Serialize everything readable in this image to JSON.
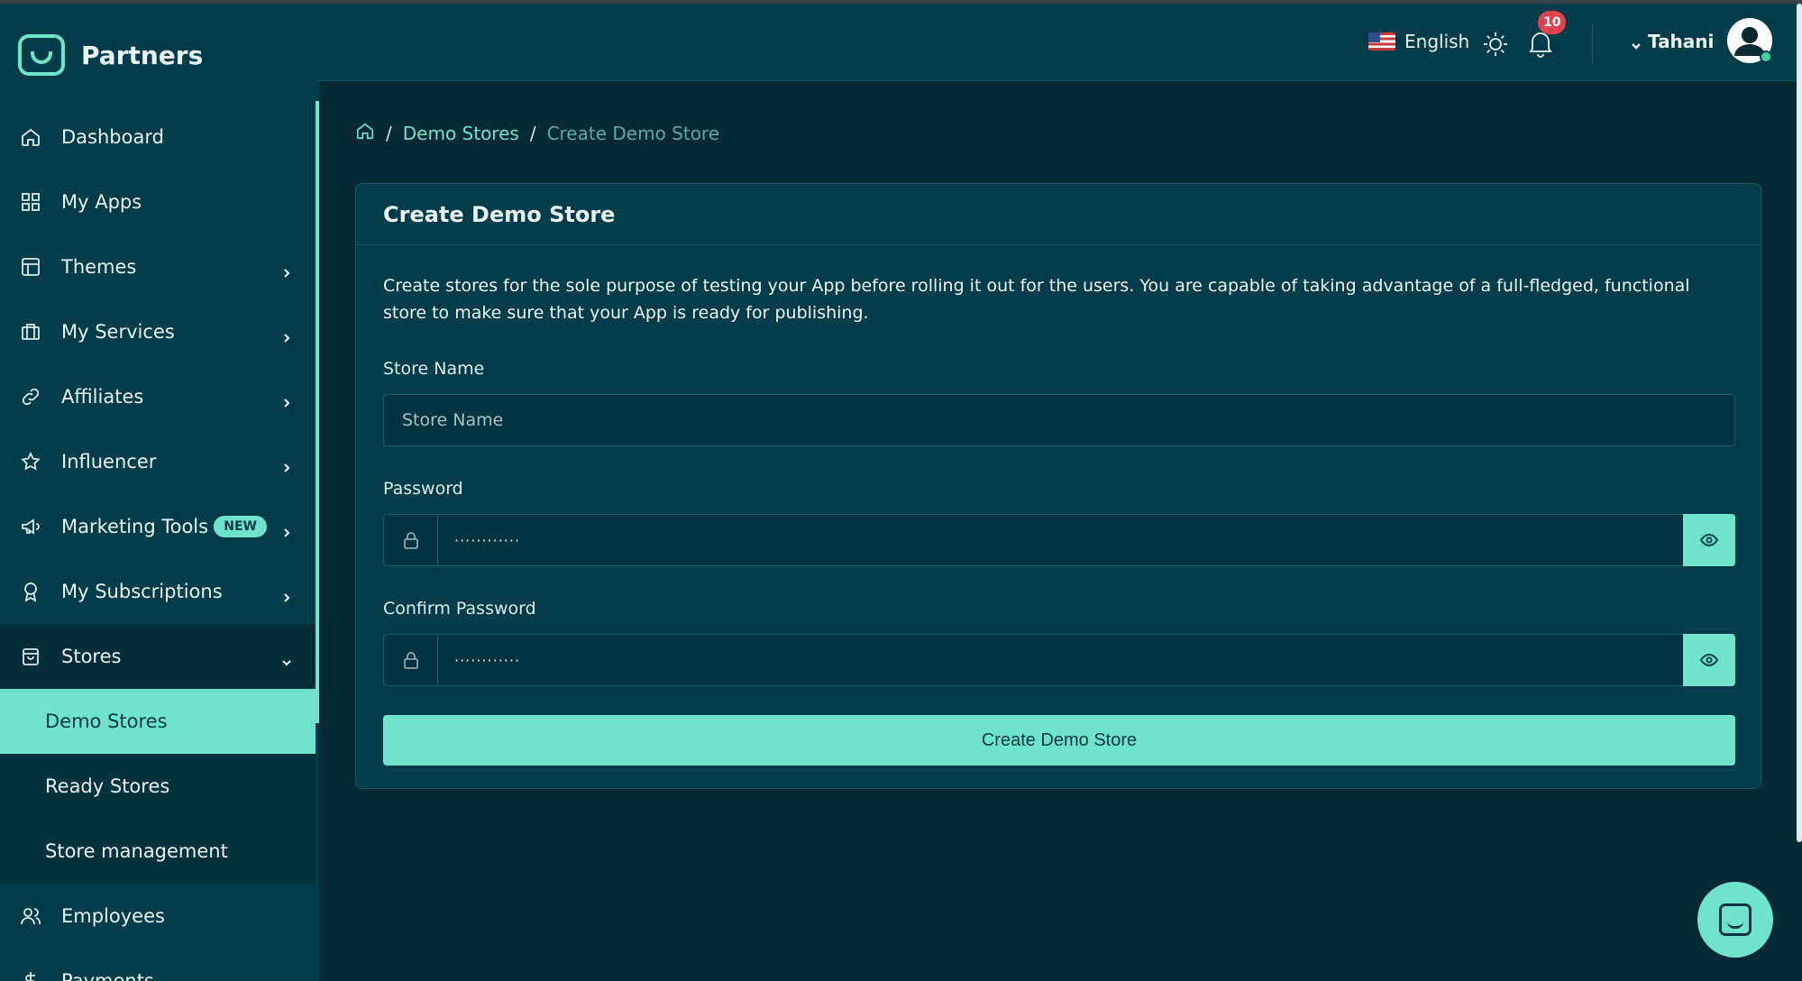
{
  "brand": {
    "name": "Partners",
    "icon": "partners-logo-icon"
  },
  "sidebar": {
    "items": [
      {
        "label": "Dashboard",
        "icon": "home-icon"
      },
      {
        "label": "My Apps",
        "icon": "grid-icon"
      },
      {
        "label": "Themes",
        "icon": "layout-icon",
        "has_submenu": true
      },
      {
        "label": "My Services",
        "icon": "briefcase-icon",
        "has_submenu": true
      },
      {
        "label": "Affiliates",
        "icon": "link-icon",
        "has_submenu": true
      },
      {
        "label": "Influencer",
        "icon": "star-icon",
        "has_submenu": true
      },
      {
        "label": "Marketing Tools",
        "icon": "megaphone-icon",
        "has_submenu": true,
        "badge": "NEW"
      },
      {
        "label": "My Subscriptions",
        "icon": "award-icon",
        "has_submenu": true
      },
      {
        "label": "Stores",
        "icon": "store-bag-icon",
        "expanded": true,
        "children": [
          {
            "label": "Demo Stores",
            "active": true
          },
          {
            "label": "Ready Stores"
          },
          {
            "label": "Store management"
          }
        ]
      },
      {
        "label": "Employees",
        "icon": "users-icon"
      },
      {
        "label": "Payments",
        "icon": "dollar-icon",
        "has_submenu": true
      }
    ]
  },
  "topbar": {
    "language": "English",
    "notifications_count": "10",
    "user_name": "Tahani"
  },
  "breadcrumb": {
    "items": [
      "Demo Stores",
      "Create Demo Store"
    ]
  },
  "form": {
    "title": "Create Demo Store",
    "description": "Create stores for the sole purpose of testing your App before rolling it out for the users. You are capable of taking advantage of a full-fledged, functional store to make sure that your App is ready for publishing.",
    "store_name_label": "Store Name",
    "store_name_placeholder": "Store Name",
    "password_label": "Password",
    "password_value": "············",
    "confirm_password_label": "Confirm Password",
    "confirm_password_value": "············",
    "submit_label": "Create Demo Store"
  },
  "colors": {
    "accent": "#6fe3cc",
    "sidebar_bg": "#003c4a",
    "page_bg": "#062a33",
    "notification_badge": "#e0414e"
  }
}
